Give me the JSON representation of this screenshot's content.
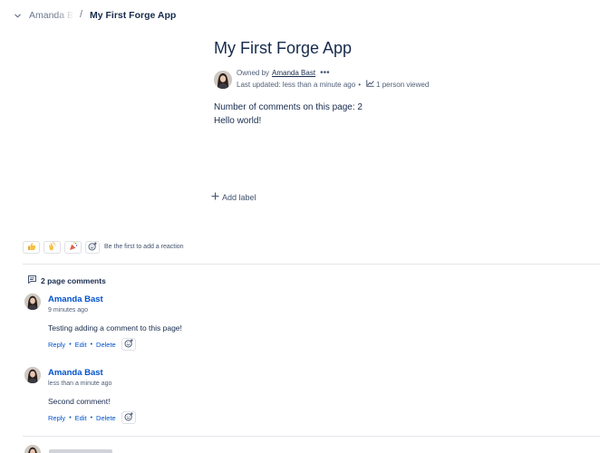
{
  "breadcrumb": {
    "parent": "Amanda Bast",
    "separator": "/",
    "current": "My First Forge App"
  },
  "page": {
    "title": "My First Forge App",
    "byline": {
      "owned_by_label": "Owned by",
      "owner": "Amanda Bast",
      "more": "•••",
      "last_updated": "Last updated: less than a minute ago",
      "bullet": "•",
      "viewed": "1 person viewed"
    },
    "body_lines": [
      "Number of comments on this page: 2",
      "Hello world!"
    ],
    "add_label": "Add label"
  },
  "reactions": {
    "buttons": [
      "thumbs-up",
      "clapping-hands",
      "party-popper"
    ],
    "prompt": "Be the first to add a reaction"
  },
  "comments_section": {
    "header": "2 page comments",
    "comments": [
      {
        "author": "Amanda Bast",
        "time": "9 minutes ago",
        "body": "Testing adding a comment to this page!",
        "actions": [
          "Reply",
          "Edit",
          "Delete"
        ]
      },
      {
        "author": "Amanda Bast",
        "time": "less than a minute ago",
        "body": "Second comment!",
        "actions": [
          "Reply",
          "Edit",
          "Delete"
        ]
      }
    ]
  },
  "colors": {
    "link": "#0052cc",
    "text": "#172b4d",
    "subtle": "#505f79",
    "border": "#dfe1e6"
  }
}
